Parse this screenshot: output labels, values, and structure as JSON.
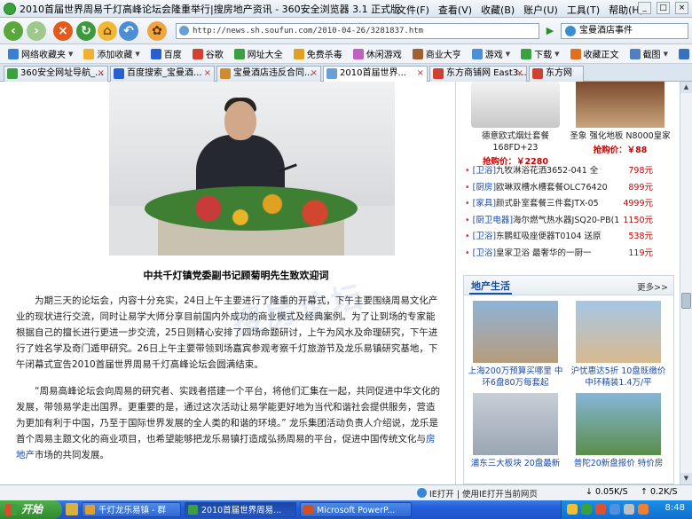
{
  "window": {
    "title": "2010首届世界周易千灯高峰论坛会隆重举行|搜房地产资讯 - 360安全浏览器 3.1 正式版",
    "menus": [
      "文件(F)",
      "查看(V)",
      "收藏(B)",
      "账户(U)",
      "工具(T)",
      "帮助(H)"
    ],
    "win_buttons": [
      "_",
      "□",
      "×"
    ]
  },
  "navbar": {
    "url": "http://news.sh.soufun.com/2010-04-26/3281837.htm",
    "search_value": "宝曼酒店事件"
  },
  "favorites": [
    {
      "label": "网络收藏夹",
      "color": "#3a7fd0"
    },
    {
      "label": "添加收藏",
      "color": "#f0b030"
    },
    {
      "label": "百度",
      "color": "#2a5fd0"
    },
    {
      "label": "谷歌",
      "color": "#d44030"
    },
    {
      "label": "网址大全",
      "color": "#3aa040"
    },
    {
      "label": "免费杀毒",
      "color": "#e0a020"
    },
    {
      "label": "休闲游戏",
      "color": "#c060c0"
    },
    {
      "label": "商业大亨",
      "color": "#a06030"
    },
    {
      "label": "游戏",
      "color": "#4a90d8"
    },
    {
      "label": "下载",
      "color": "#3aa040"
    },
    {
      "label": "收藏正文",
      "color": "#e07020"
    },
    {
      "label": "截图",
      "color": "#5080c0"
    },
    {
      "label": "翻译",
      "color": "#3a70c0"
    }
  ],
  "tabs": [
    {
      "label": "360安全网址导航_...",
      "color": "#3aa040",
      "active": false
    },
    {
      "label": "百度搜索_宝曼酒...",
      "color": "#2a5fd0",
      "active": false
    },
    {
      "label": "宝曼酒店违反合同...",
      "color": "#d08a30",
      "active": false
    },
    {
      "label": "2010首届世界...",
      "color": "#6a9ed8",
      "active": true
    },
    {
      "label": "东方商铺网 East3...",
      "color": "#d04030",
      "active": false
    },
    {
      "label": "东方网",
      "color": "#d04030",
      "active": false
    }
  ],
  "article": {
    "caption": "中共千灯镇党委副书记顾菊明先生致欢迎词",
    "para1": "为期三天的论坛会，内容十分充实，24日上午主要进行了隆重的开幕式，下午主要围绕周易文化产业的现状进行交流，同时让易学大师分享目前国内外成功的商业模式及经典案例。为了让到场的专家能根据自己的擅长进行更进一步交流，25日则精心安排了四场命题研讨，上午为风水及命理研究，下午进行了姓名学及奇门遁甲研究。26日上午主要带领到场嘉宾参观考察千灯旅游节及龙乐易镇研究基地，下午闭幕式宣告2010首届世界周易千灯高峰论坛会圆满结束。",
    "para2_a": "“周易高峰论坛会向周易的研究者、实践者搭建一个平台，将他们汇集在一起，共同促进中华文化的发展，带领易学走出国界。更重要的是，通过这次活动让易学能更好地为当代和谐社会提供服务，营造为更加有利于中国，乃至于国际世界发展的全人类的和谐的环境。” 龙乐集团活动负责人介绍说，龙乐是首个周易主题文化的商业项目，也希望能够把龙乐易镇打造成弘扬周易的平台，促进中国传统文化与",
    "para2_link": "房地产",
    "para2_b": "市场的共同发展。",
    "watermark": "搜房论坛"
  },
  "sidebar": {
    "products": [
      {
        "name": "德意欧式烟灶套餐168FD+23",
        "price": "抢购价：￥2280"
      },
      {
        "name": "圣象 强化地板 N8000皇家",
        "price": "抢购价：￥88"
      }
    ],
    "list": [
      {
        "cat": "[卫浴]",
        "name": "九牧淋浴花洒3652-041 全",
        "price": "798元"
      },
      {
        "cat": "[厨房]",
        "name": "欧琳双槽水槽套餐OLC76420",
        "price": "899元"
      },
      {
        "cat": "[家具]",
        "name": "颜式卧室套餐三件套JTX-05",
        "price": "4999元"
      },
      {
        "cat": "[厨卫电器]",
        "name": "海尔燃气热水器JSQ20-PB(1",
        "price": "1150元"
      },
      {
        "cat": "[卫浴]",
        "name": "东鹏虹吸座便器T0104 送原",
        "price": "538元"
      },
      {
        "cat": "[卫浴]",
        "name": "皇家卫浴 最奢华的一厨一",
        "price": "119元"
      }
    ],
    "estate_title": "地产生活",
    "estate_more": "更多>>",
    "estate_items": [
      "上海200万预算买哪里 中环6盘80万每套起",
      "沪忧惠达5折 10盘既缴价中环精装1.4万/平",
      "浦东三大板块 20盘最新",
      "普陀20新盘报价 特价房"
    ]
  },
  "statusbar": {
    "text": "IE打开 | 使用IE打开当前网页",
    "download": "0.05K/S",
    "upload": "0.2K/S"
  },
  "taskbar": {
    "start": "开始",
    "tasks": [
      {
        "label": "千灯龙乐易镇 - 群",
        "color": "#e0a030",
        "active": false
      },
      {
        "label": "2010首届世界周易...",
        "color": "#3aa040",
        "active": true
      },
      {
        "label": "Microsoft PowerP...",
        "color": "#d05020",
        "active": false
      }
    ],
    "clock": "8:48"
  }
}
